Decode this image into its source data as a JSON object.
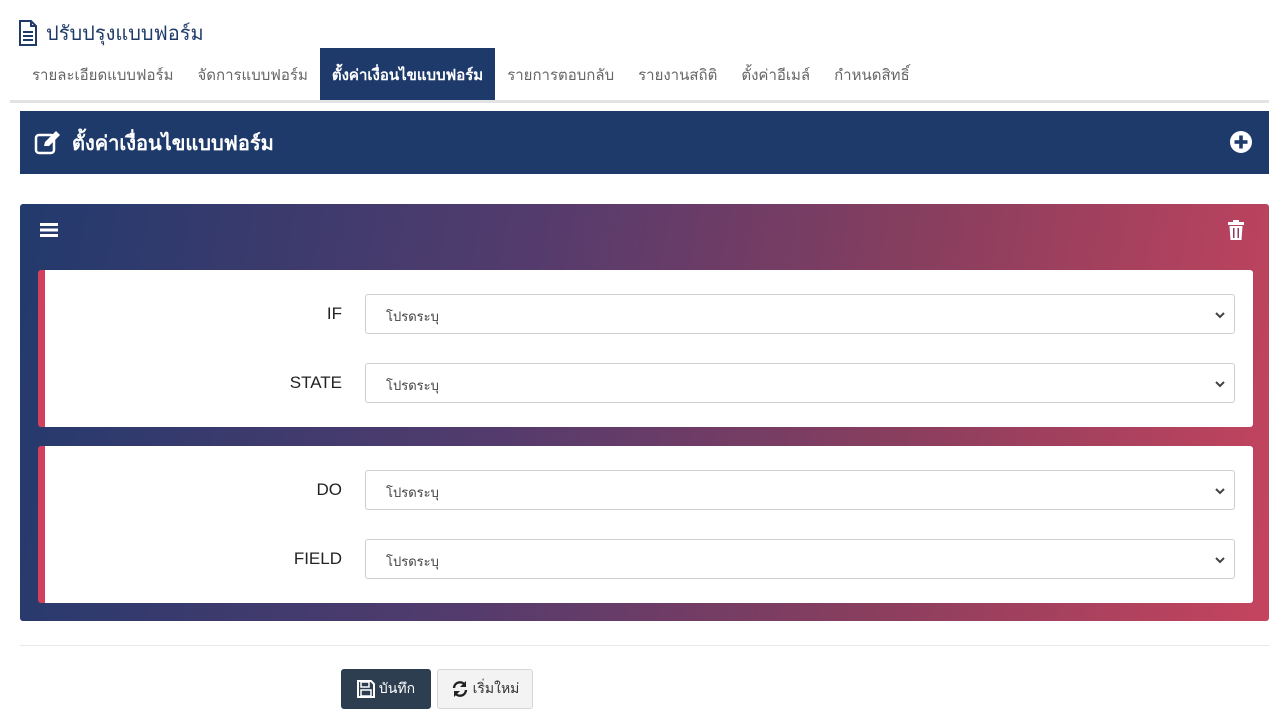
{
  "page": {
    "title": "ปรับปรุงแบบฟอร์ม",
    "icon": "document-icon"
  },
  "tabs": [
    {
      "label": "รายละเอียดแบบฟอร์ม",
      "active": false
    },
    {
      "label": "จัดการแบบฟอร์ม",
      "active": false
    },
    {
      "label": "ตั้งค่าเงื่อนไขแบบฟอร์ม",
      "active": true
    },
    {
      "label": "รายการตอบกลับ",
      "active": false
    },
    {
      "label": "รายงานสถิติ",
      "active": false
    },
    {
      "label": "ตั้งค่าอีเมล์",
      "active": false
    },
    {
      "label": "กำหนดสิทธิ์",
      "active": false
    }
  ],
  "section": {
    "title": "ตั้งค่าเงื่อนไขแบบฟอร์ม",
    "icon": "edit-icon",
    "add_icon": "plus-circle-icon"
  },
  "condition": {
    "menu_icon": "hamburger-menu-icon",
    "delete_icon": "trash-icon",
    "if_fields": [
      {
        "label": "IF",
        "value": "โปรดระบุ"
      },
      {
        "label": "STATE",
        "value": "โปรดระบุ"
      }
    ],
    "do_fields": [
      {
        "label": "DO",
        "value": "โปรดระบุ"
      },
      {
        "label": "FIELD",
        "value": "โปรดระบุ"
      }
    ]
  },
  "actions": {
    "save_label": "บันทึก",
    "save_icon": "save-icon",
    "reset_label": "เริ่มใหม่",
    "reset_icon": "refresh-icon"
  },
  "colors": {
    "primary": "#1e3a6b",
    "accent": "#d2405e",
    "gradient_start": "#223a6d",
    "gradient_end": "#c5445e"
  }
}
